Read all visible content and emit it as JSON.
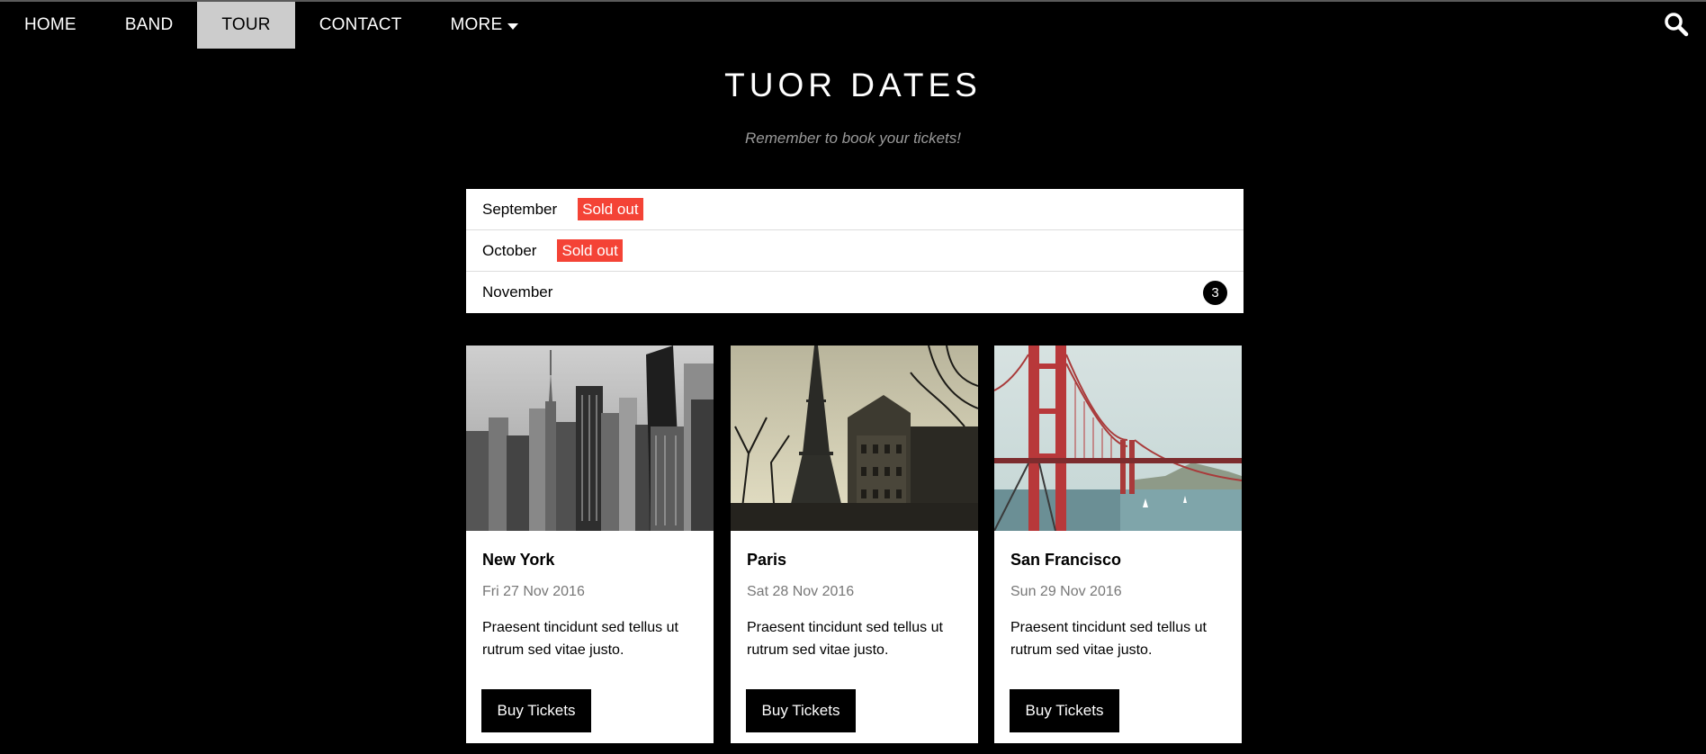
{
  "nav": {
    "items": [
      {
        "label": "HOME"
      },
      {
        "label": "BAND"
      },
      {
        "label": "TOUR"
      },
      {
        "label": "CONTACT"
      },
      {
        "label": "MORE"
      }
    ],
    "active": "TOUR",
    "search_icon": "search-icon"
  },
  "header": {
    "title": "TUOR DATES",
    "subtitle": "Remember to book your tickets!"
  },
  "months": [
    {
      "label": "September",
      "badge": "Sold out"
    },
    {
      "label": "October",
      "badge": "Sold out"
    },
    {
      "label": "November",
      "count": "3"
    }
  ],
  "cards": [
    {
      "city": "New York",
      "date": "Fri 27 Nov 2016",
      "desc": "Praesent tincidunt sed tellus ut rutrum sed vitae justo.",
      "button": "Buy Tickets"
    },
    {
      "city": "Paris",
      "date": "Sat 28 Nov 2016",
      "desc": "Praesent tincidunt sed tellus ut rutrum sed vitae justo.",
      "button": "Buy Tickets"
    },
    {
      "city": "San Francisco",
      "date": "Sun 29 Nov 2016",
      "desc": "Praesent tincidunt sed tellus ut rutrum sed vitae justo.",
      "button": "Buy Tickets"
    }
  ],
  "colors": {
    "background": "#000000",
    "active_tab": "#cccccc",
    "sold_out": "#f44336",
    "card": "#ffffff"
  }
}
